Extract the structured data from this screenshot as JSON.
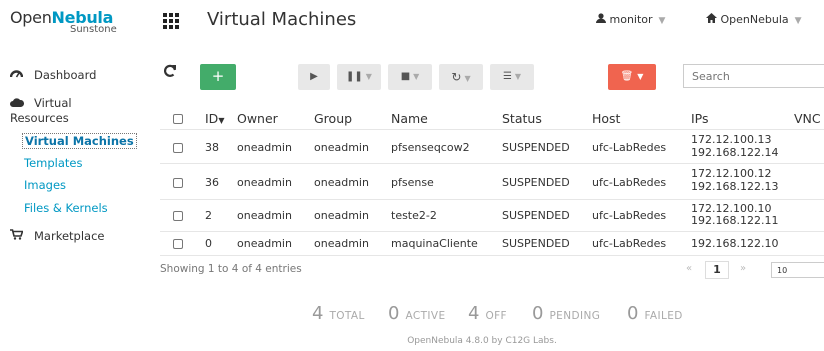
{
  "sidebar": {
    "logo_brand_1": "Open",
    "logo_brand_2": "Nebula",
    "logo_sub": "Sunstone",
    "dashboard": "Dashboard",
    "virtual_line1": "Virtual",
    "virtual_line2": "Resources",
    "sub_items": [
      "Virtual Machines",
      "Templates",
      "Images",
      "Files & Kernels"
    ],
    "marketplace": "Marketplace"
  },
  "header": {
    "title": "Virtual Machines",
    "user": "monitor",
    "zone": "OpenNebula"
  },
  "toolbar": {
    "add_label": "+",
    "search_placeholder": "Search"
  },
  "table": {
    "columns": [
      "ID",
      "Owner",
      "Group",
      "Name",
      "Status",
      "Host",
      "IPs",
      "VNC"
    ],
    "rows": [
      {
        "id": "38",
        "owner": "oneadmin",
        "group": "oneadmin",
        "name": "pfsenseqcow2",
        "status": "SUSPENDED",
        "host": "ufc-LabRedes",
        "ip1": "172.12.100.13",
        "ip2": "192.168.122.14"
      },
      {
        "id": "36",
        "owner": "oneadmin",
        "group": "oneadmin",
        "name": "pfsense",
        "status": "SUSPENDED",
        "host": "ufc-LabRedes",
        "ip1": "172.12.100.12",
        "ip2": "192.168.122.13"
      },
      {
        "id": "2",
        "owner": "oneadmin",
        "group": "oneadmin",
        "name": "teste2-2",
        "status": "SUSPENDED",
        "host": "ufc-LabRedes",
        "ip1": "172.12.100.10",
        "ip2": "192.168.122.11"
      },
      {
        "id": "0",
        "owner": "oneadmin",
        "group": "oneadmin",
        "name": "maquinaCliente",
        "status": "SUSPENDED",
        "host": "ufc-LabRedes",
        "ip1": "192.168.122.10",
        "ip2": ""
      }
    ],
    "entries_text": "Showing 1 to 4 of 4 entries",
    "pager_prev": "«",
    "pager_current": "1",
    "pager_next": "»",
    "page_size": "10"
  },
  "stats": [
    {
      "num": "4",
      "label": "TOTAL"
    },
    {
      "num": "0",
      "label": "ACTIVE"
    },
    {
      "num": "4",
      "label": "OFF"
    },
    {
      "num": "0",
      "label": "PENDING"
    },
    {
      "num": "0",
      "label": "FAILED"
    }
  ],
  "footer": "OpenNebula 4.8.0 by C12G Labs.",
  "colors": {
    "brand": "#0098c3",
    "add": "#43ac6a",
    "delete": "#f0644f"
  },
  "icons": [
    "grid-icon",
    "user-icon",
    "home-icon",
    "refresh-icon",
    "play-icon",
    "pause-icon",
    "stop-icon",
    "reboot-icon",
    "list-icon",
    "trash-icon",
    "dashboard-icon",
    "cloud-icon",
    "cart-icon",
    "sort-desc-icon"
  ]
}
